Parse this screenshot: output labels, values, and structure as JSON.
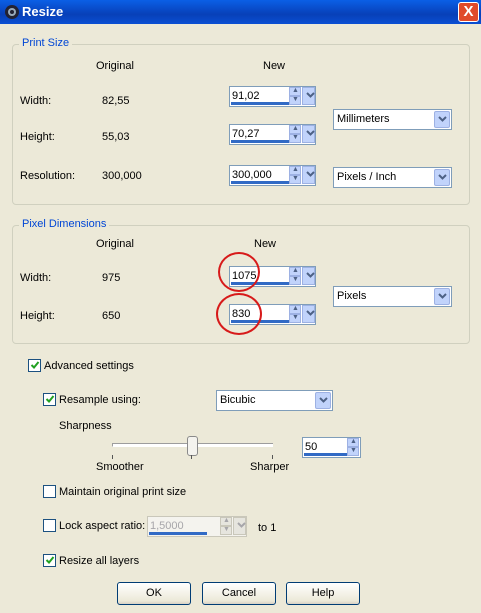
{
  "window": {
    "title": "Resize",
    "close_label": "X"
  },
  "print_size": {
    "legend": "Print Size",
    "col_original": "Original",
    "col_new": "New",
    "rows": [
      {
        "label": "Width:",
        "original": "82,55",
        "new": "91,02"
      },
      {
        "label": "Height:",
        "original": "55,03",
        "new": "70,27"
      },
      {
        "label": "Resolution:",
        "original": "300,000",
        "new": "300,000"
      }
    ],
    "units": "Millimeters",
    "resolution_units": "Pixels / Inch"
  },
  "pixel_dimensions": {
    "legend": "Pixel Dimensions",
    "col_original": "Original",
    "col_new": "New",
    "rows": [
      {
        "label": "Width:",
        "original": "975",
        "new": "1075"
      },
      {
        "label": "Height:",
        "original": "650",
        "new": "830"
      }
    ],
    "units": "Pixels"
  },
  "advanced": {
    "label": "Advanced settings",
    "checked": true,
    "resample_label": "Resample using:",
    "resample_checked": true,
    "resample_method": "Bicubic",
    "sharpness_label": "Sharpness",
    "sharpness_value": "50",
    "sharpness_level": 0.5,
    "smoother_label": "Smoother",
    "sharper_label": "Sharper",
    "maintain_label": "Maintain original print size",
    "maintain_checked": false,
    "lock_label": "Lock aspect ratio:",
    "lock_checked": false,
    "lock_value": "1,5000",
    "lock_suffix": "to 1",
    "resize_layers_label": "Resize all layers",
    "resize_layers_checked": true
  },
  "buttons": {
    "ok": "OK",
    "cancel": "Cancel",
    "help": "Help"
  }
}
